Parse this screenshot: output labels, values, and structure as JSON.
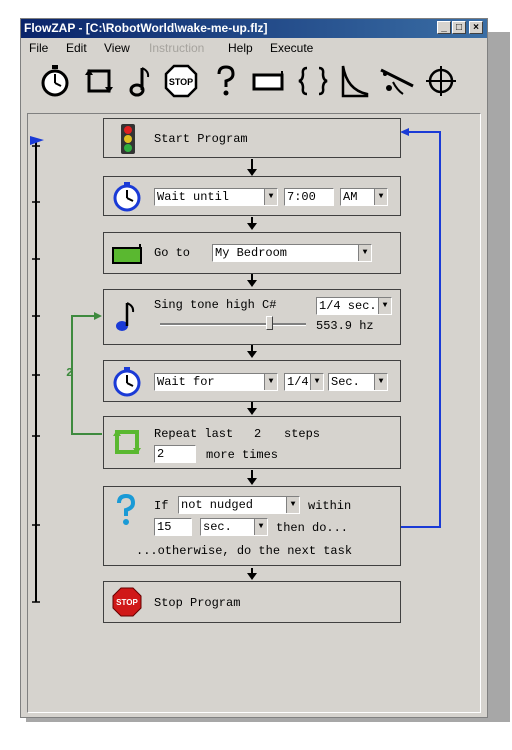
{
  "window": {
    "title": "FlowZAP - [C:\\RobotWorld\\wake-me-up.flz]",
    "controls": [
      "_",
      "□",
      "×"
    ]
  },
  "menu": [
    {
      "label": "File",
      "enabled": true
    },
    {
      "label": "Edit",
      "enabled": true
    },
    {
      "label": "View",
      "enabled": true
    },
    {
      "label": "Instruction",
      "enabled": false
    },
    {
      "label": "Help",
      "enabled": true
    },
    {
      "label": "Execute",
      "enabled": true
    }
  ],
  "toolbar_icons": [
    "stopwatch-icon",
    "repeat-icon",
    "music-note-icon",
    "stop-sign-icon",
    "question-mark-icon",
    "rectangle-icon",
    "braces-icon",
    "ramp-icon",
    "sensor-icon",
    "crosshair-icon"
  ],
  "steps": {
    "start": {
      "label": "Start Program"
    },
    "wait_until": {
      "mode": "Wait until",
      "time": "7:00",
      "ampm": "AM"
    },
    "goto": {
      "label": "Go to",
      "place": "My Bedroom"
    },
    "sing": {
      "label": "Sing tone high C#",
      "duration": "1/4 sec.",
      "freq": "553.9 hz",
      "slider_level": 0.75
    },
    "wait_for": {
      "mode": "Wait for",
      "amount": "1/4",
      "unit": "Sec."
    },
    "repeat": {
      "label_a": "Repeat last",
      "count": "2",
      "label_b": "steps",
      "times_value": "2",
      "label_c": "more times",
      "loop_label": "2"
    },
    "if": {
      "label_if": "If",
      "condition": "not nudged",
      "label_within": "within",
      "seconds": "15",
      "unit": "sec.",
      "label_then": "then do...",
      "otherwise": "...otherwise, do the next task"
    },
    "stop": {
      "label": "Stop Program",
      "icon_text": "STOP"
    }
  },
  "colors": {
    "title_start": "#0a246a",
    "title_end": "#3a6ea5",
    "jump_line": "#1a3ad6",
    "loop_line": "#3e8a3e",
    "panel": "#d6d3ce"
  }
}
